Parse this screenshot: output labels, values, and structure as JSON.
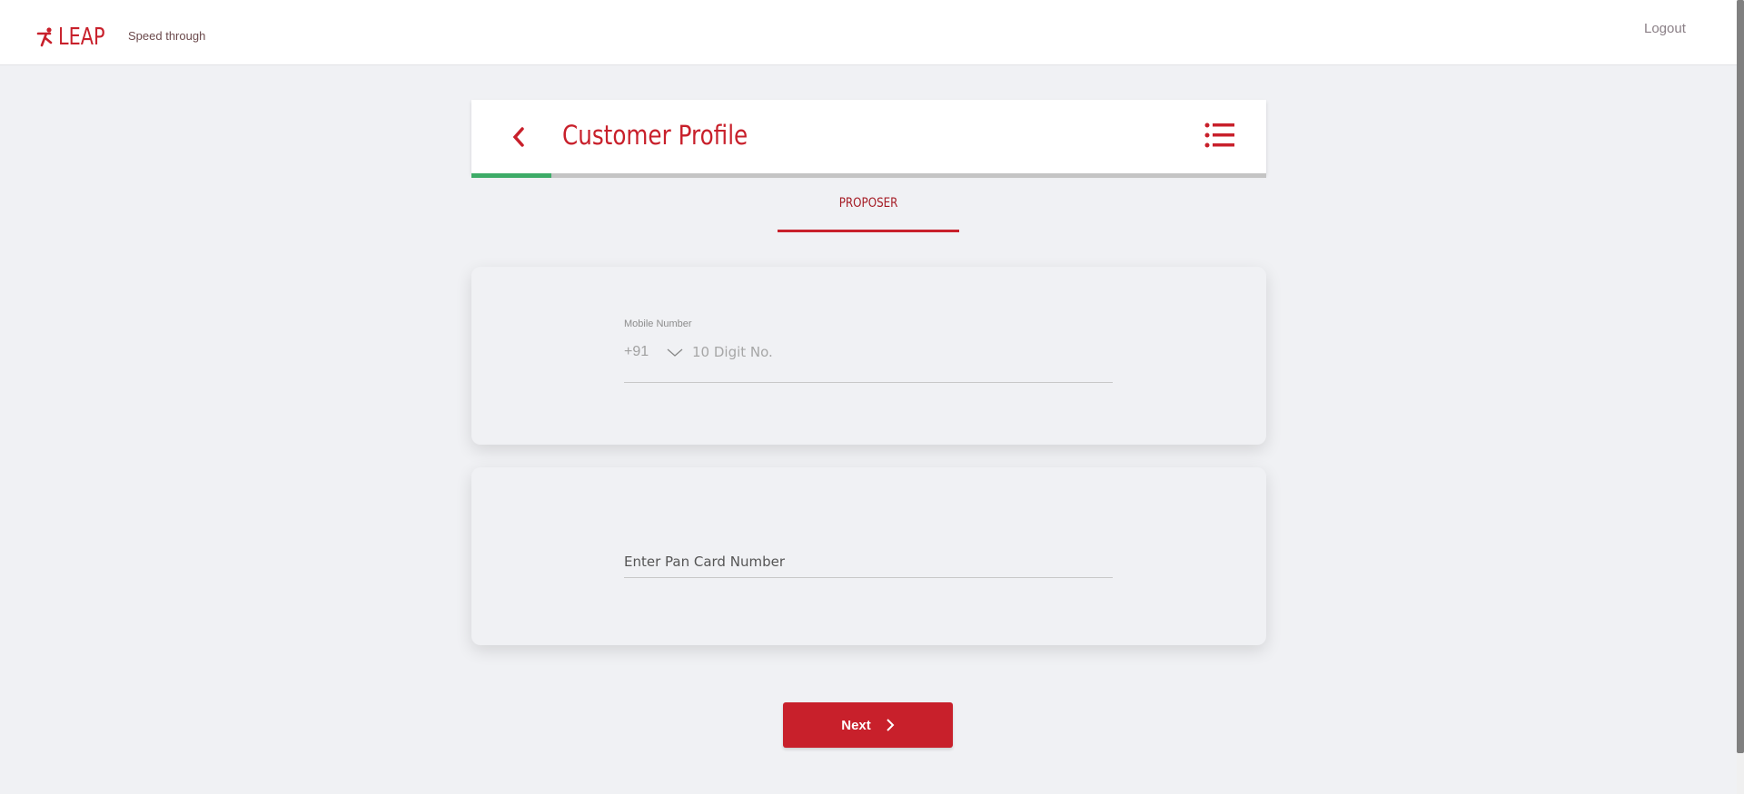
{
  "header": {
    "brand": "LEAP",
    "tagline": "Speed through",
    "logout": "Logout"
  },
  "page": {
    "title": "Customer Profile",
    "progress_percent": 10
  },
  "tabs": [
    {
      "label": "PROPOSER",
      "active": true
    }
  ],
  "mobile": {
    "label": "Mobile Number",
    "country_code": "+91",
    "placeholder": "10 Digit No."
  },
  "pan": {
    "placeholder": "Enter Pan Card Number"
  },
  "actions": {
    "next": "Next"
  },
  "colors": {
    "brand": "#c8202b",
    "progress": "#3dab67",
    "background": "#f0f1f4"
  }
}
